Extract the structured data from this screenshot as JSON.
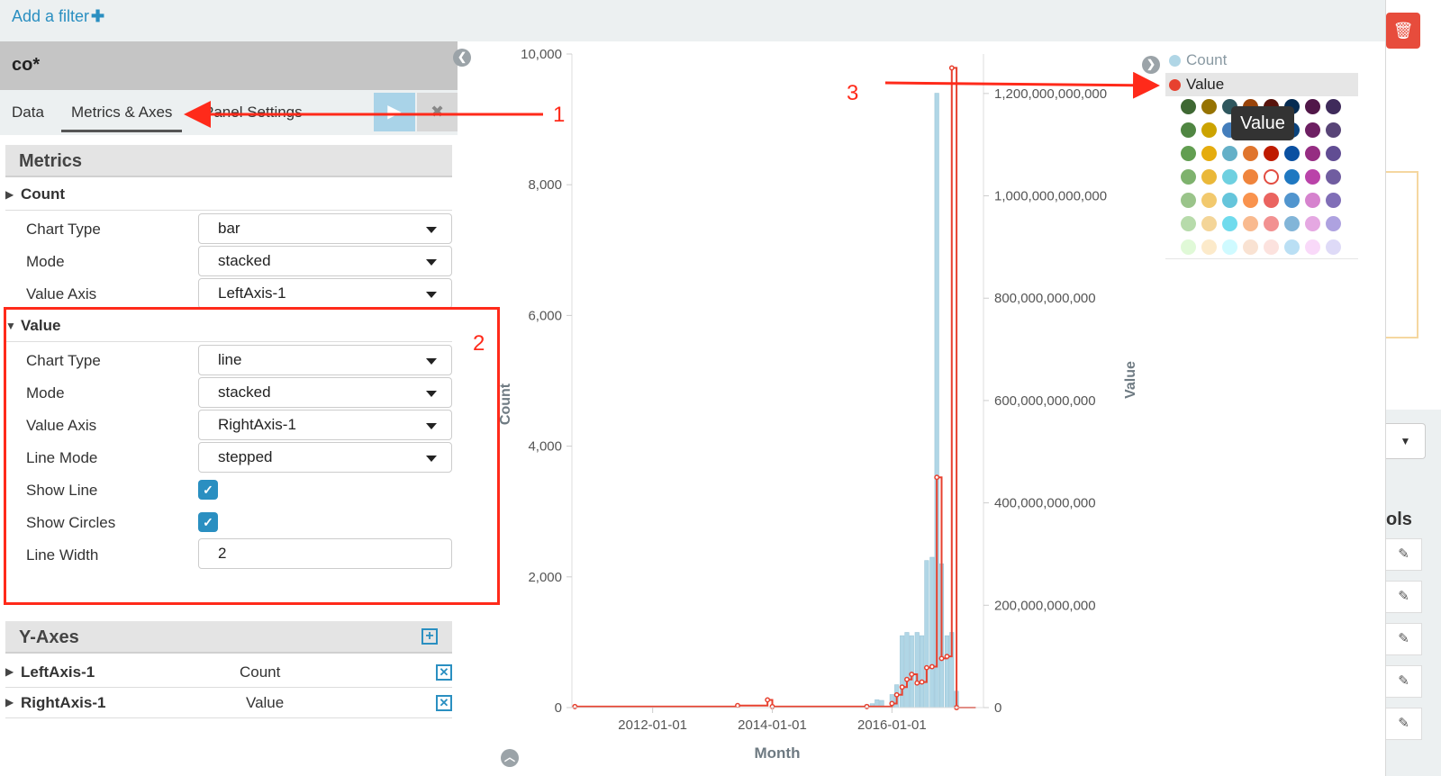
{
  "filter_bar": {
    "add_filter_label": "Add a filter"
  },
  "editor": {
    "title": "co*",
    "tabs": [
      {
        "label": "Data"
      },
      {
        "label": "Metrics & Axes"
      },
      {
        "label": "Panel Settings"
      }
    ],
    "metrics_header": "Metrics",
    "count_series": {
      "name": "Count",
      "chart_type_label": "Chart Type",
      "chart_type": "bar",
      "mode_label": "Mode",
      "mode": "stacked",
      "value_axis_label": "Value Axis",
      "value_axis": "LeftAxis-1"
    },
    "value_series": {
      "name": "Value",
      "chart_type_label": "Chart Type",
      "chart_type": "line",
      "mode_label": "Mode",
      "mode": "stacked",
      "value_axis_label": "Value Axis",
      "value_axis": "RightAxis-1",
      "line_mode_label": "Line Mode",
      "line_mode": "stepped",
      "show_line_label": "Show Line",
      "show_line": true,
      "show_circles_label": "Show Circles",
      "show_circles": true,
      "line_width_label": "Line Width",
      "line_width": "2"
    },
    "y_axes_header": "Y-Axes",
    "y_axes": [
      {
        "name": "LeftAxis-1",
        "label": "Count"
      },
      {
        "name": "RightAxis-1",
        "label": "Value"
      }
    ]
  },
  "annotations": [
    "1",
    "2",
    "3"
  ],
  "legend": {
    "items": [
      {
        "label": "Count",
        "color": "#b0d6e6"
      },
      {
        "label": "Value",
        "color": "#e7412f"
      }
    ],
    "tooltip": "Value",
    "palette_rows": [
      [
        "#3f6833",
        "#967302",
        "#2f575e",
        "#99440a",
        "#58140c",
        "#052b51",
        "#511749",
        "#3f2b5b"
      ],
      [
        "#508642",
        "#cca300",
        "#447ebc",
        "#c15c17",
        "#890f02",
        "#0a437c",
        "#6d1f62",
        "#584477"
      ],
      [
        "#629e51",
        "#e5ac0e",
        "#64b0c8",
        "#e0752d",
        "#bf1b00",
        "#0a50a1",
        "#962d82",
        "#614d93"
      ],
      [
        "#7eb26d",
        "#eab839",
        "#6ed0e0",
        "#ef843c",
        "#e24d42",
        "#1f78c1",
        "#ba43a9",
        "#705da0"
      ],
      [
        "#9ac48a",
        "#f2c96d",
        "#65c5db",
        "#f9934e",
        "#ea6460",
        "#5195ce",
        "#d683ce",
        "#806eb7"
      ],
      [
        "#b7dbab",
        "#f4d598",
        "#70dbed",
        "#f9ba8f",
        "#f29191",
        "#82b5d8",
        "#e5a8e2",
        "#aea2e0"
      ],
      [
        "#e0f9d7",
        "#fceaca",
        "#cffaff",
        "#f9e2d2",
        "#fce2de",
        "#badff4",
        "#f9d9f9",
        "#dedaf7"
      ]
    ],
    "selected_color": "#e24d42"
  },
  "chart_data": {
    "type": "bar",
    "xlabel": "Month",
    "ylabel_left": "Count",
    "ylabel_right": "Value",
    "x_ticks": [
      "2012-01-01",
      "2014-01-01",
      "2016-01-01"
    ],
    "y_left_ticks": [
      "0",
      "2,000",
      "4,000",
      "6,000",
      "8,000",
      "10,000"
    ],
    "y_right_ticks": [
      "0",
      "200,000,000,000",
      "400,000,000,000",
      "600,000,000,000",
      "800,000,000,000",
      "1,000,000,000,000",
      "1,200,000,000,000"
    ],
    "ylim_left": [
      0,
      10000
    ],
    "ylim_right": [
      0,
      1300000000000
    ],
    "x_range_years": [
      2010.65,
      2017.5
    ],
    "series": [
      {
        "name": "Count",
        "chart_type": "bar",
        "axis": "left",
        "color": "#b0d6e6",
        "points": [
          [
            2013.42,
            15
          ],
          [
            2014.0,
            20
          ],
          [
            2015.58,
            45
          ],
          [
            2015.67,
            60
          ],
          [
            2015.75,
            120
          ],
          [
            2015.83,
            110
          ],
          [
            2016.0,
            200
          ],
          [
            2016.08,
            350
          ],
          [
            2016.17,
            1100
          ],
          [
            2016.25,
            1150
          ],
          [
            2016.33,
            1100
          ],
          [
            2016.42,
            1150
          ],
          [
            2016.5,
            1100
          ],
          [
            2016.58,
            2250
          ],
          [
            2016.67,
            2300
          ],
          [
            2016.75,
            9400
          ],
          [
            2016.83,
            2200
          ],
          [
            2016.92,
            1100
          ],
          [
            2017.0,
            1150
          ],
          [
            2017.08,
            250
          ]
        ]
      },
      {
        "name": "Value",
        "chart_type": "line",
        "line_mode": "stepped",
        "axis": "right",
        "color": "#e7412f",
        "points": [
          [
            2010.7,
            2000000000
          ],
          [
            2013.42,
            4000000000
          ],
          [
            2013.92,
            15000000000
          ],
          [
            2014.0,
            2000000000
          ],
          [
            2015.58,
            2000000000
          ],
          [
            2016.0,
            8000000000
          ],
          [
            2016.08,
            25000000000
          ],
          [
            2016.17,
            40000000000
          ],
          [
            2016.25,
            55000000000
          ],
          [
            2016.33,
            65000000000
          ],
          [
            2016.42,
            48000000000
          ],
          [
            2016.5,
            50000000000
          ],
          [
            2016.58,
            78000000000
          ],
          [
            2016.67,
            80000000000
          ],
          [
            2016.75,
            450000000000
          ],
          [
            2016.83,
            96000000000
          ],
          [
            2016.92,
            100000000000
          ],
          [
            2017.0,
            1250000000000
          ],
          [
            2017.08,
            0
          ]
        ]
      }
    ]
  }
}
